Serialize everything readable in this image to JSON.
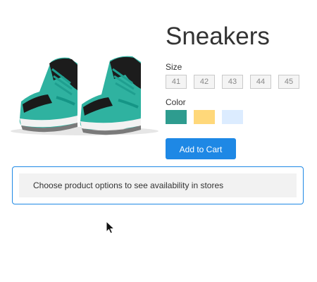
{
  "product": {
    "title": "Sneakers",
    "image_alt": "sneakers-product-image"
  },
  "size": {
    "label": "Size",
    "options": [
      "41",
      "42",
      "43",
      "44",
      "45"
    ]
  },
  "color": {
    "label": "Color",
    "swatches": [
      {
        "name": "teal",
        "hex": "#2e9c8f"
      },
      {
        "name": "yellow",
        "hex": "#ffd87a"
      },
      {
        "name": "light-blue",
        "hex": "#dcecff"
      }
    ]
  },
  "cart": {
    "button_label": "Add to Cart",
    "accent": "#1e88e5"
  },
  "availability": {
    "message": "Choose product options to see availability in stores"
  }
}
